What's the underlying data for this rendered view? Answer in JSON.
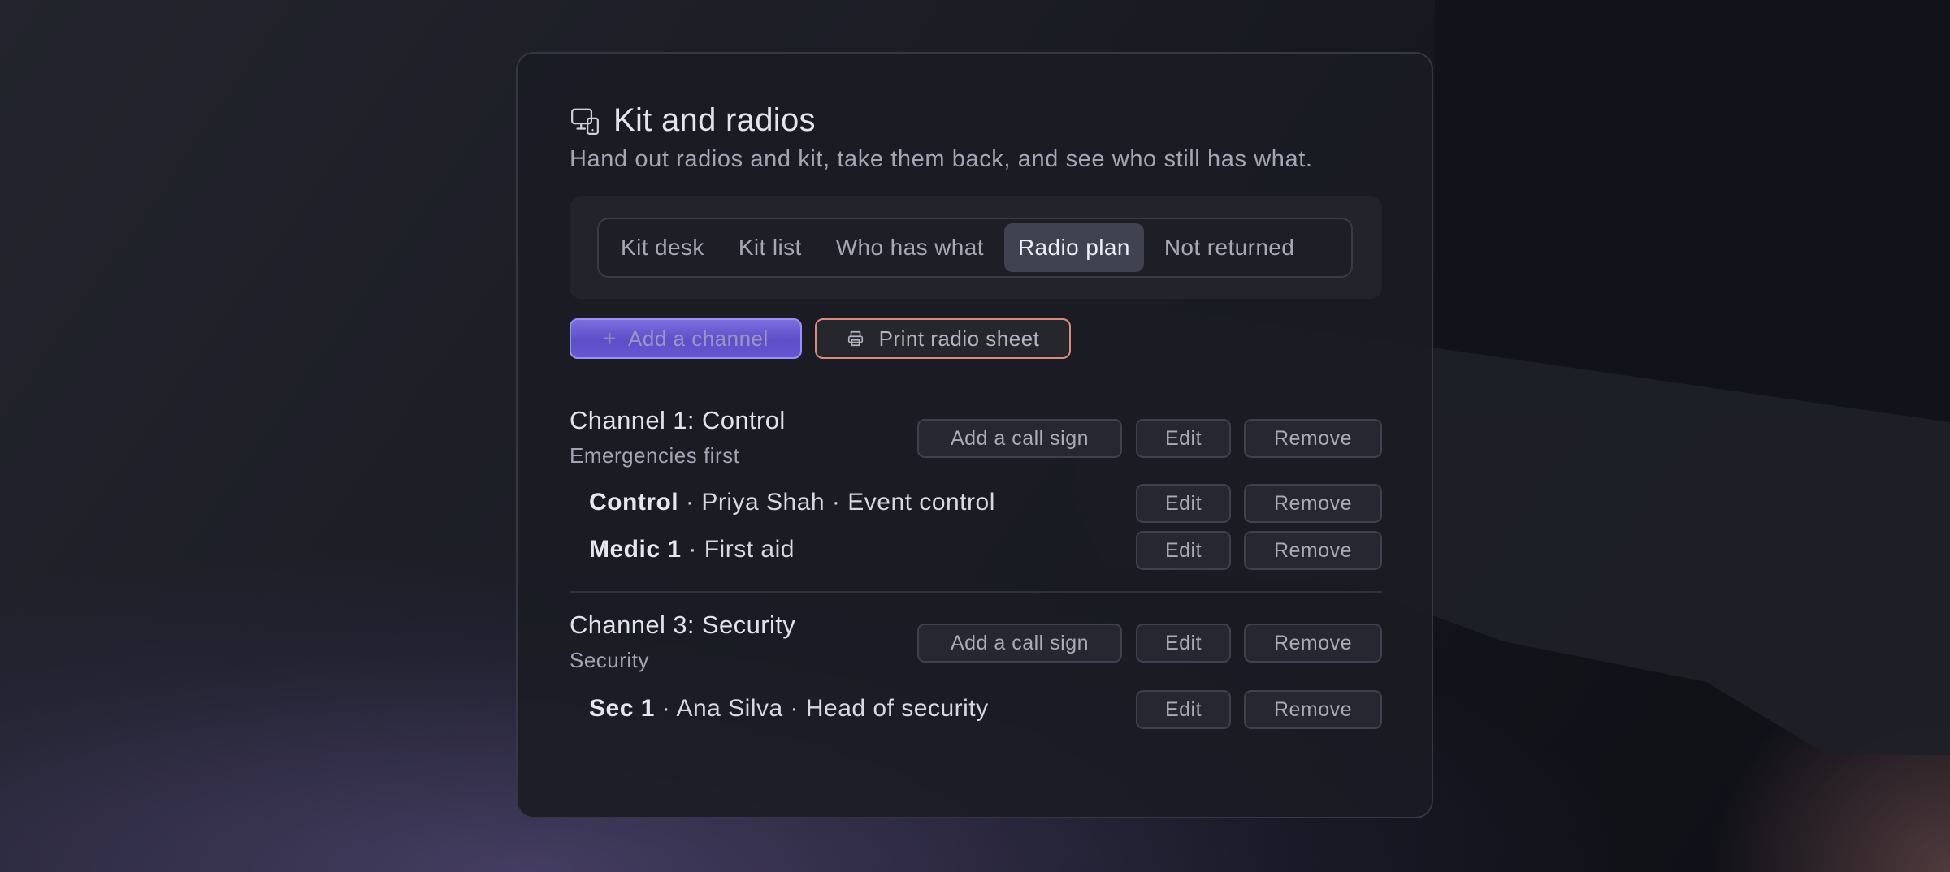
{
  "header": {
    "icon": "devices-icon",
    "title": "Kit and radios",
    "subtitle": "Hand out radios and kit, take them back, and see who still has what."
  },
  "tabs": [
    {
      "label": "Kit desk",
      "active": false
    },
    {
      "label": "Kit list",
      "active": false
    },
    {
      "label": "Who has what",
      "active": false
    },
    {
      "label": "Radio plan",
      "active": true
    },
    {
      "label": "Not returned",
      "active": false
    }
  ],
  "toolbar": {
    "add_channel_label": "Add a channel",
    "print_label": "Print radio sheet"
  },
  "separator": "·",
  "actions": {
    "add_call_sign": "Add a call sign",
    "edit": "Edit",
    "remove": "Remove"
  },
  "channels": [
    {
      "name": "Channel 1: Control",
      "description": "Emergencies first",
      "call_signs": [
        {
          "sign": "Control",
          "person": "Priya Shah",
          "role": "Event control"
        },
        {
          "sign": "Medic 1",
          "role": "First aid"
        }
      ]
    },
    {
      "name": "Channel 3: Security",
      "description": "Security",
      "call_signs": [
        {
          "sign": "Sec 1",
          "person": "Ana Silva",
          "role": "Head of security"
        }
      ]
    }
  ]
}
